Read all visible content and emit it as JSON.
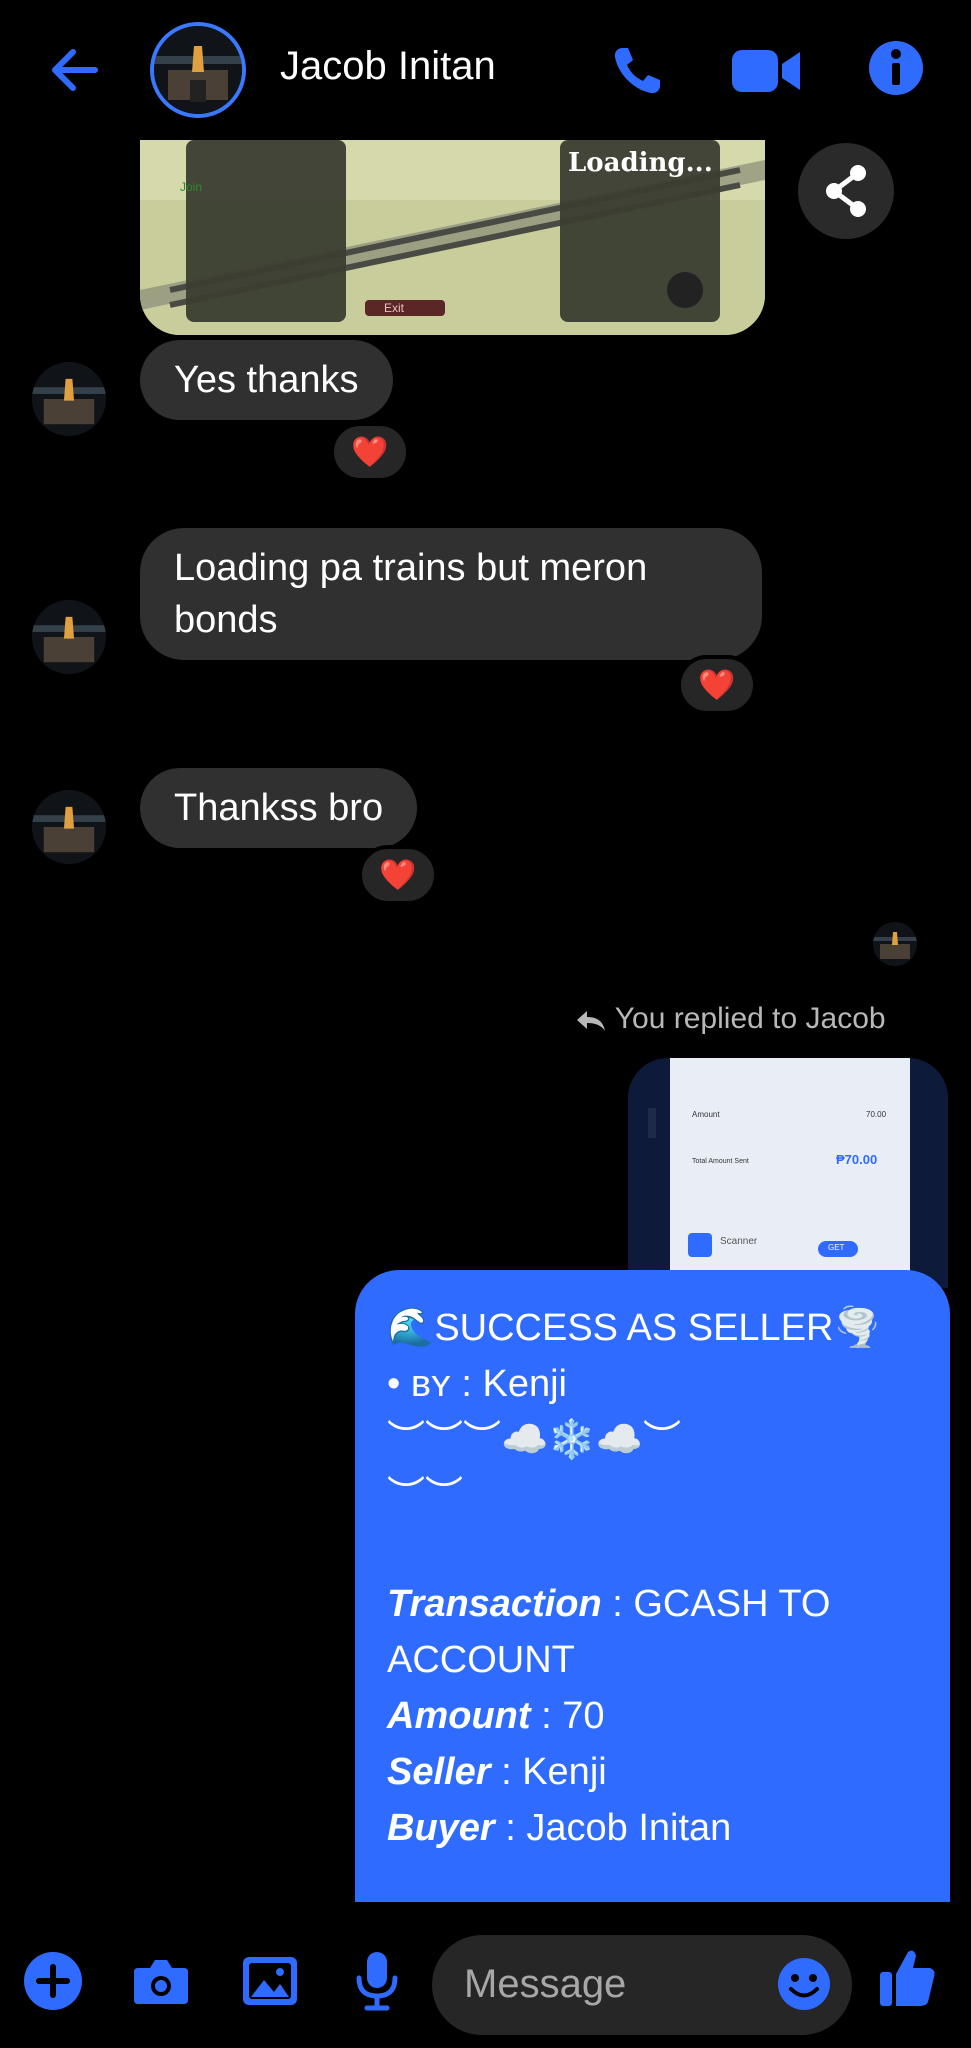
{
  "header": {
    "contact_name": "Jacob Initan"
  },
  "image_message": {
    "loading_text": "Loading...",
    "join_text": "Join",
    "exit_text": "Exit"
  },
  "messages": [
    {
      "text": "Yes thanks",
      "reaction": "❤️"
    },
    {
      "text": "Loading pa trains but meron bonds",
      "reaction": "❤️"
    },
    {
      "text": "Thankss bro",
      "reaction": "❤️"
    }
  ],
  "reply_note": "You replied to Jacob",
  "reply_preview": {
    "amount_label": "Amount",
    "amount_value": "70.00",
    "total_label": "Total Amount Sent",
    "total_value": "₱70.00",
    "app_label": "Scanner",
    "get_label": "GET"
  },
  "sent_message": {
    "line1": "🌊SUCCESS AS SELLER🌪️",
    "line2_prefix": "• ʙʏ : ",
    "line2_name": "Kenji",
    "line3": "︶︶︶☁️❄️☁️︶",
    "line4": "︶︶",
    "transaction_label": "Transaction",
    "transaction_value": " : GCASH TO ACCOUNT",
    "amount_label": "Amount",
    "amount_value": " : 70",
    "seller_label": "Seller",
    "seller_value": " : Kenji",
    "buyer_label": "Buyer",
    "buyer_value": " : Jacob Initan"
  },
  "composer": {
    "placeholder": "Message"
  },
  "colors": {
    "accent": "#2f6bff",
    "bubble_received": "#303030",
    "heart": "#ff2b3a"
  }
}
